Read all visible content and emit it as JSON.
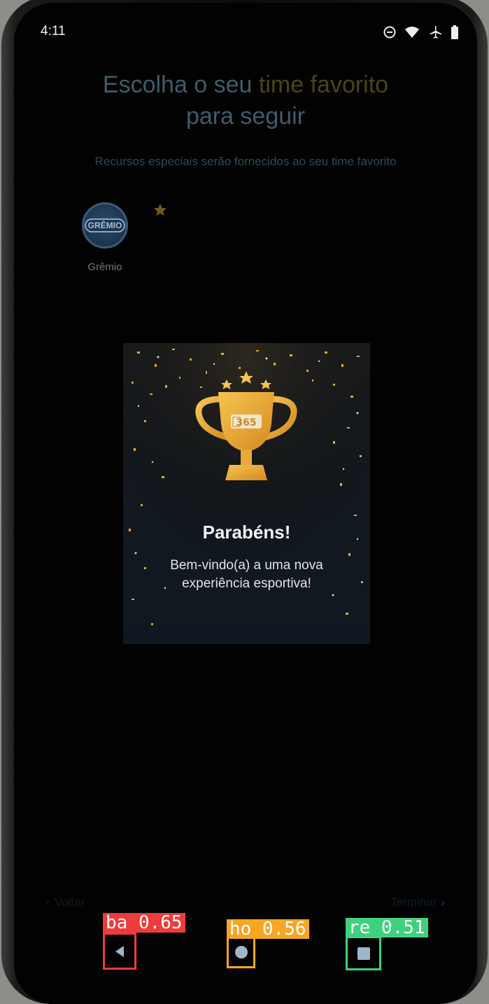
{
  "status_bar": {
    "time": "4:11",
    "icons": [
      "do-not-disturb-icon",
      "wifi-icon",
      "airplane-icon",
      "battery-icon"
    ]
  },
  "onboarding": {
    "title_line1_prefix": "Escolha o seu ",
    "title_line1_highlight": "time favorito",
    "title_line2": "para seguir",
    "subtitle": "Recursos especiais serão fornecidos ao seu time favorito",
    "team": {
      "logo_text": "GRÊMIO",
      "name": "Grêmio",
      "favorite": true
    },
    "back_label": "Voltar",
    "finish_label": "Terminar"
  },
  "modal": {
    "badge_text": "365",
    "title": "Parabéns!",
    "body": "Bem-vindo(a) a uma nova experiência esportiva!"
  },
  "detections": [
    {
      "label": "ba 0.65",
      "class": "back",
      "color": "#ef3b3b"
    },
    {
      "label": "ho 0.56",
      "class": "home",
      "color": "#f5a623"
    },
    {
      "label": "re 0.51",
      "class": "recents",
      "color": "#3fd27c"
    }
  ],
  "colors": {
    "accent_gold": "#e6ac2c",
    "title_dim": "#3d5d6c"
  }
}
